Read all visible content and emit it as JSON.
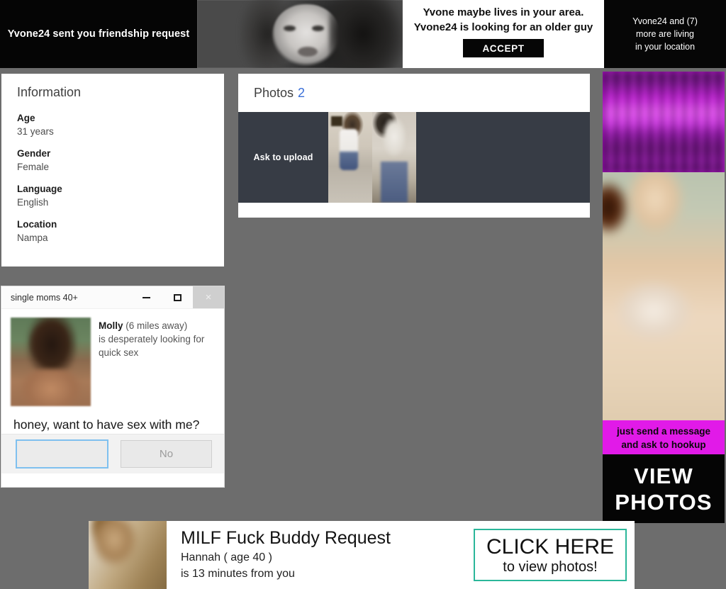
{
  "colors": {
    "desktop_background": "#6d6d6d",
    "accent_blue": "#3a6fd8",
    "photo_strip_dark": "#373c45",
    "ad_magenta": "#e11ae8",
    "cta_teal": "#2bb79a",
    "badge_red": "#ef4d3d",
    "focus_blue": "#7fc0ef"
  },
  "top_banner": {
    "left_ad_text": "Yvone24 sent you  friendship request",
    "center_ad": {
      "line1": "Yvone maybe lives in your area.",
      "line2": "Yvone24 is looking for  an older guy",
      "accept_label": "ACCEPT"
    },
    "right_ad": {
      "line1": "Yvone24  and (7)",
      "line2": "more are living",
      "line3": "in your location"
    }
  },
  "information_card": {
    "title": "Information",
    "fields": [
      {
        "label": "Age",
        "value": "31 years"
      },
      {
        "label": "Gender",
        "value": "Female"
      },
      {
        "label": "Language",
        "value": "English"
      },
      {
        "label": "Location",
        "value": "Nampa"
      }
    ]
  },
  "photos_card": {
    "title": "Photos",
    "count": "2",
    "ask_to_upload_label": "Ask to upload"
  },
  "dialog": {
    "title": "single moms 40+",
    "window_controls": {
      "minimize": "minimize-icon",
      "maximize": "maximize-icon",
      "close": "×"
    },
    "sender_name": "Molly",
    "sender_distance": " (6 miles away)",
    "message_line1": "is desperately looking for",
    "message_line2": "quick sex",
    "question": "honey, want to have sex with me?",
    "yes_button_label": "",
    "no_button_label": "No"
  },
  "sidebar_ads": {
    "top_blurred_ad_note": "",
    "bottom_ad": {
      "pink_line1": "just send a message",
      "pink_line2": "and ask to hookup",
      "black_line1": "VIEW",
      "black_line2": "PHOTOS"
    }
  },
  "bottom_banner": {
    "title": "MILF Fuck Buddy Request",
    "sub_line1": "Hannah ( age 40 )",
    "sub_line2": "is 13 minutes from you",
    "badge": "!",
    "cta_line1": "CLICK HERE",
    "cta_line2": "to view photos!"
  }
}
